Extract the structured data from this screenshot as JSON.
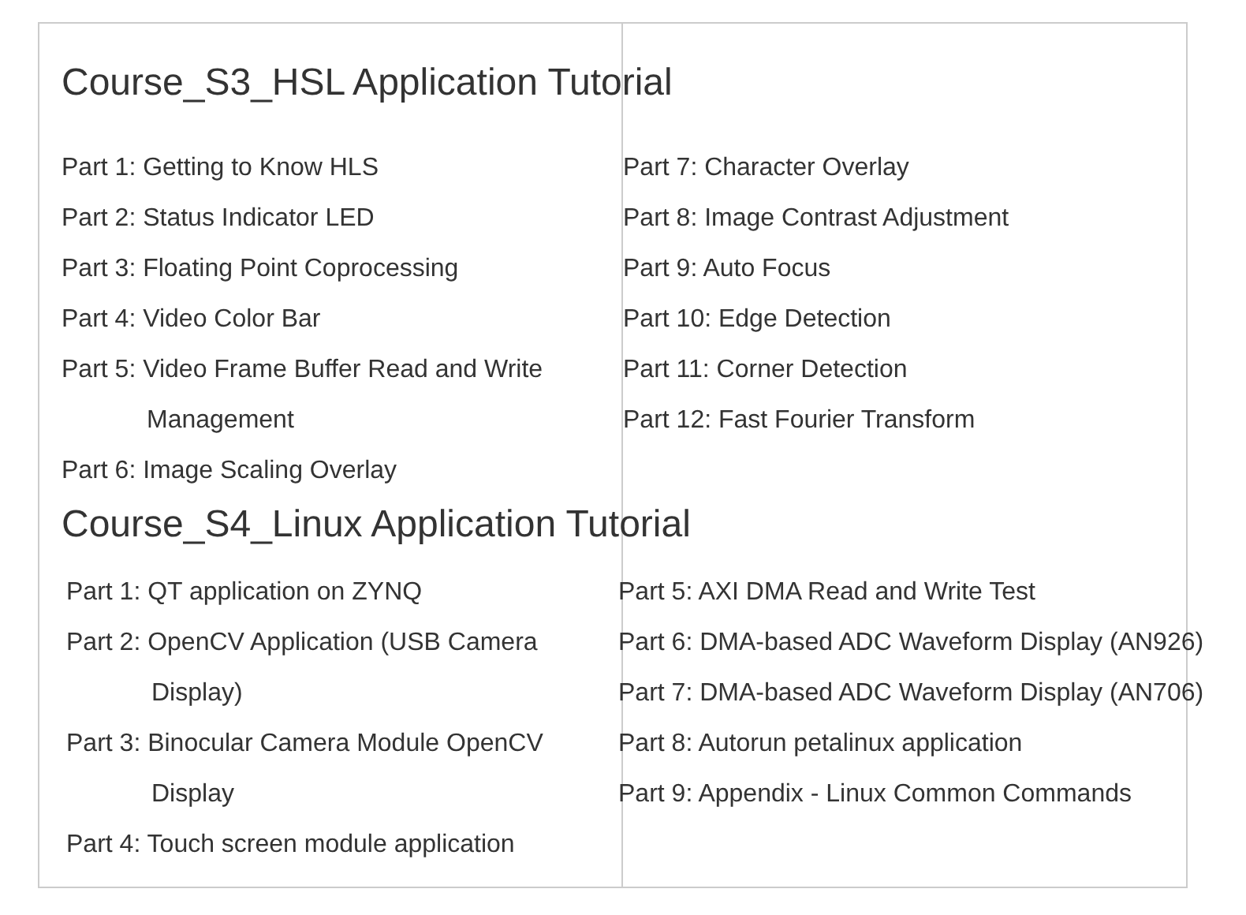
{
  "sections": [
    {
      "title": "Course_S3_HSL Application Tutorial",
      "left": [
        "Part 1: Getting to Know HLS",
        "Part 2: Status Indicator LED",
        "Part 3: Floating Point Coprocessing",
        "Part 4: Video Color Bar",
        "Part 5: Video Frame Buffer Read and Write Management",
        "Part 6: Image Scaling Overlay"
      ],
      "right": [
        "Part 7: Character Overlay",
        "Part 8: Image Contrast Adjustment",
        "Part 9: Auto Focus",
        "Part 10: Edge Detection",
        "Part 11: Corner Detection",
        "Part 12: Fast Fourier Transform"
      ]
    },
    {
      "title": "Course_S4_Linux Application Tutorial",
      "left": [
        "Part 1: QT application on ZYNQ",
        "Part 2: OpenCV Application (USB Camera Display)",
        "Part 3: Binocular Camera Module OpenCV Display",
        "Part 4: Touch screen module application"
      ],
      "right": [
        "Part 5: AXI DMA Read and Write Test",
        "Part 6: DMA-based ADC Waveform Display (AN926)",
        "Part 7: DMA-based ADC Waveform Display (AN706)",
        "Part 8: Autorun petalinux application",
        "Part 9: Appendix - Linux Common Commands"
      ]
    }
  ]
}
